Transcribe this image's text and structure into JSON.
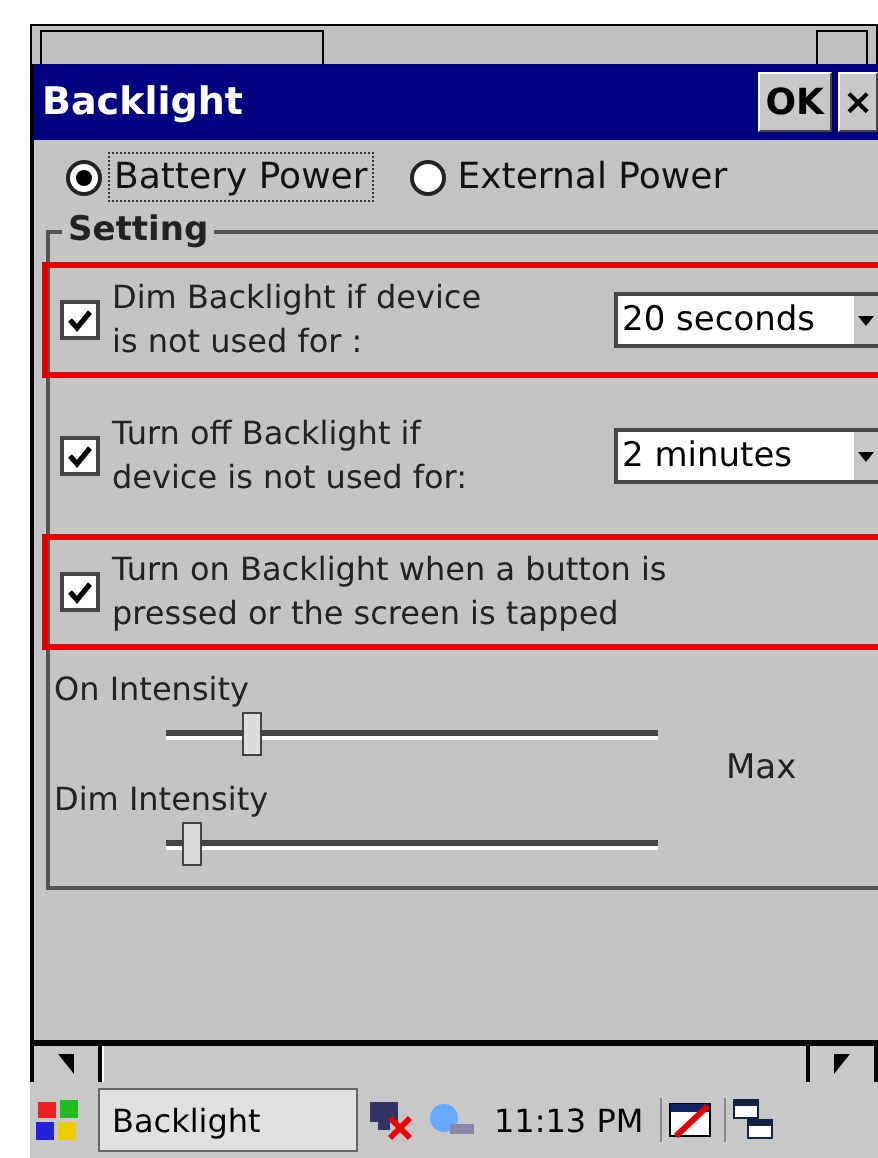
{
  "window": {
    "title": "Backlight",
    "ok_label": "OK",
    "close_label": "×"
  },
  "power_source": [
    {
      "label": "Battery Power",
      "selected": true
    },
    {
      "label": "External Power",
      "selected": false
    }
  ],
  "setting_group": {
    "title": "Setting"
  },
  "options": [
    {
      "kind": "dropdown",
      "label": "Dim Backlight if device is not used for :",
      "checked": true,
      "highlighted": true,
      "value": "20 seconds"
    },
    {
      "kind": "dropdown",
      "label": "Turn off Backlight if device is not used for:",
      "checked": true,
      "highlighted": false,
      "value": "2 minutes"
    },
    {
      "kind": "check",
      "label": "Turn on Backlight when a button is pressed or the screen is tapped",
      "checked": true,
      "highlighted": true
    }
  ],
  "sliders": [
    {
      "label": "On Intensity",
      "level": 0.17
    },
    {
      "label": "Dim Intensity",
      "level": 0.05
    }
  ],
  "max_label": "Max",
  "taskbar": {
    "task": "Backlight",
    "clock": "11:13 PM"
  }
}
